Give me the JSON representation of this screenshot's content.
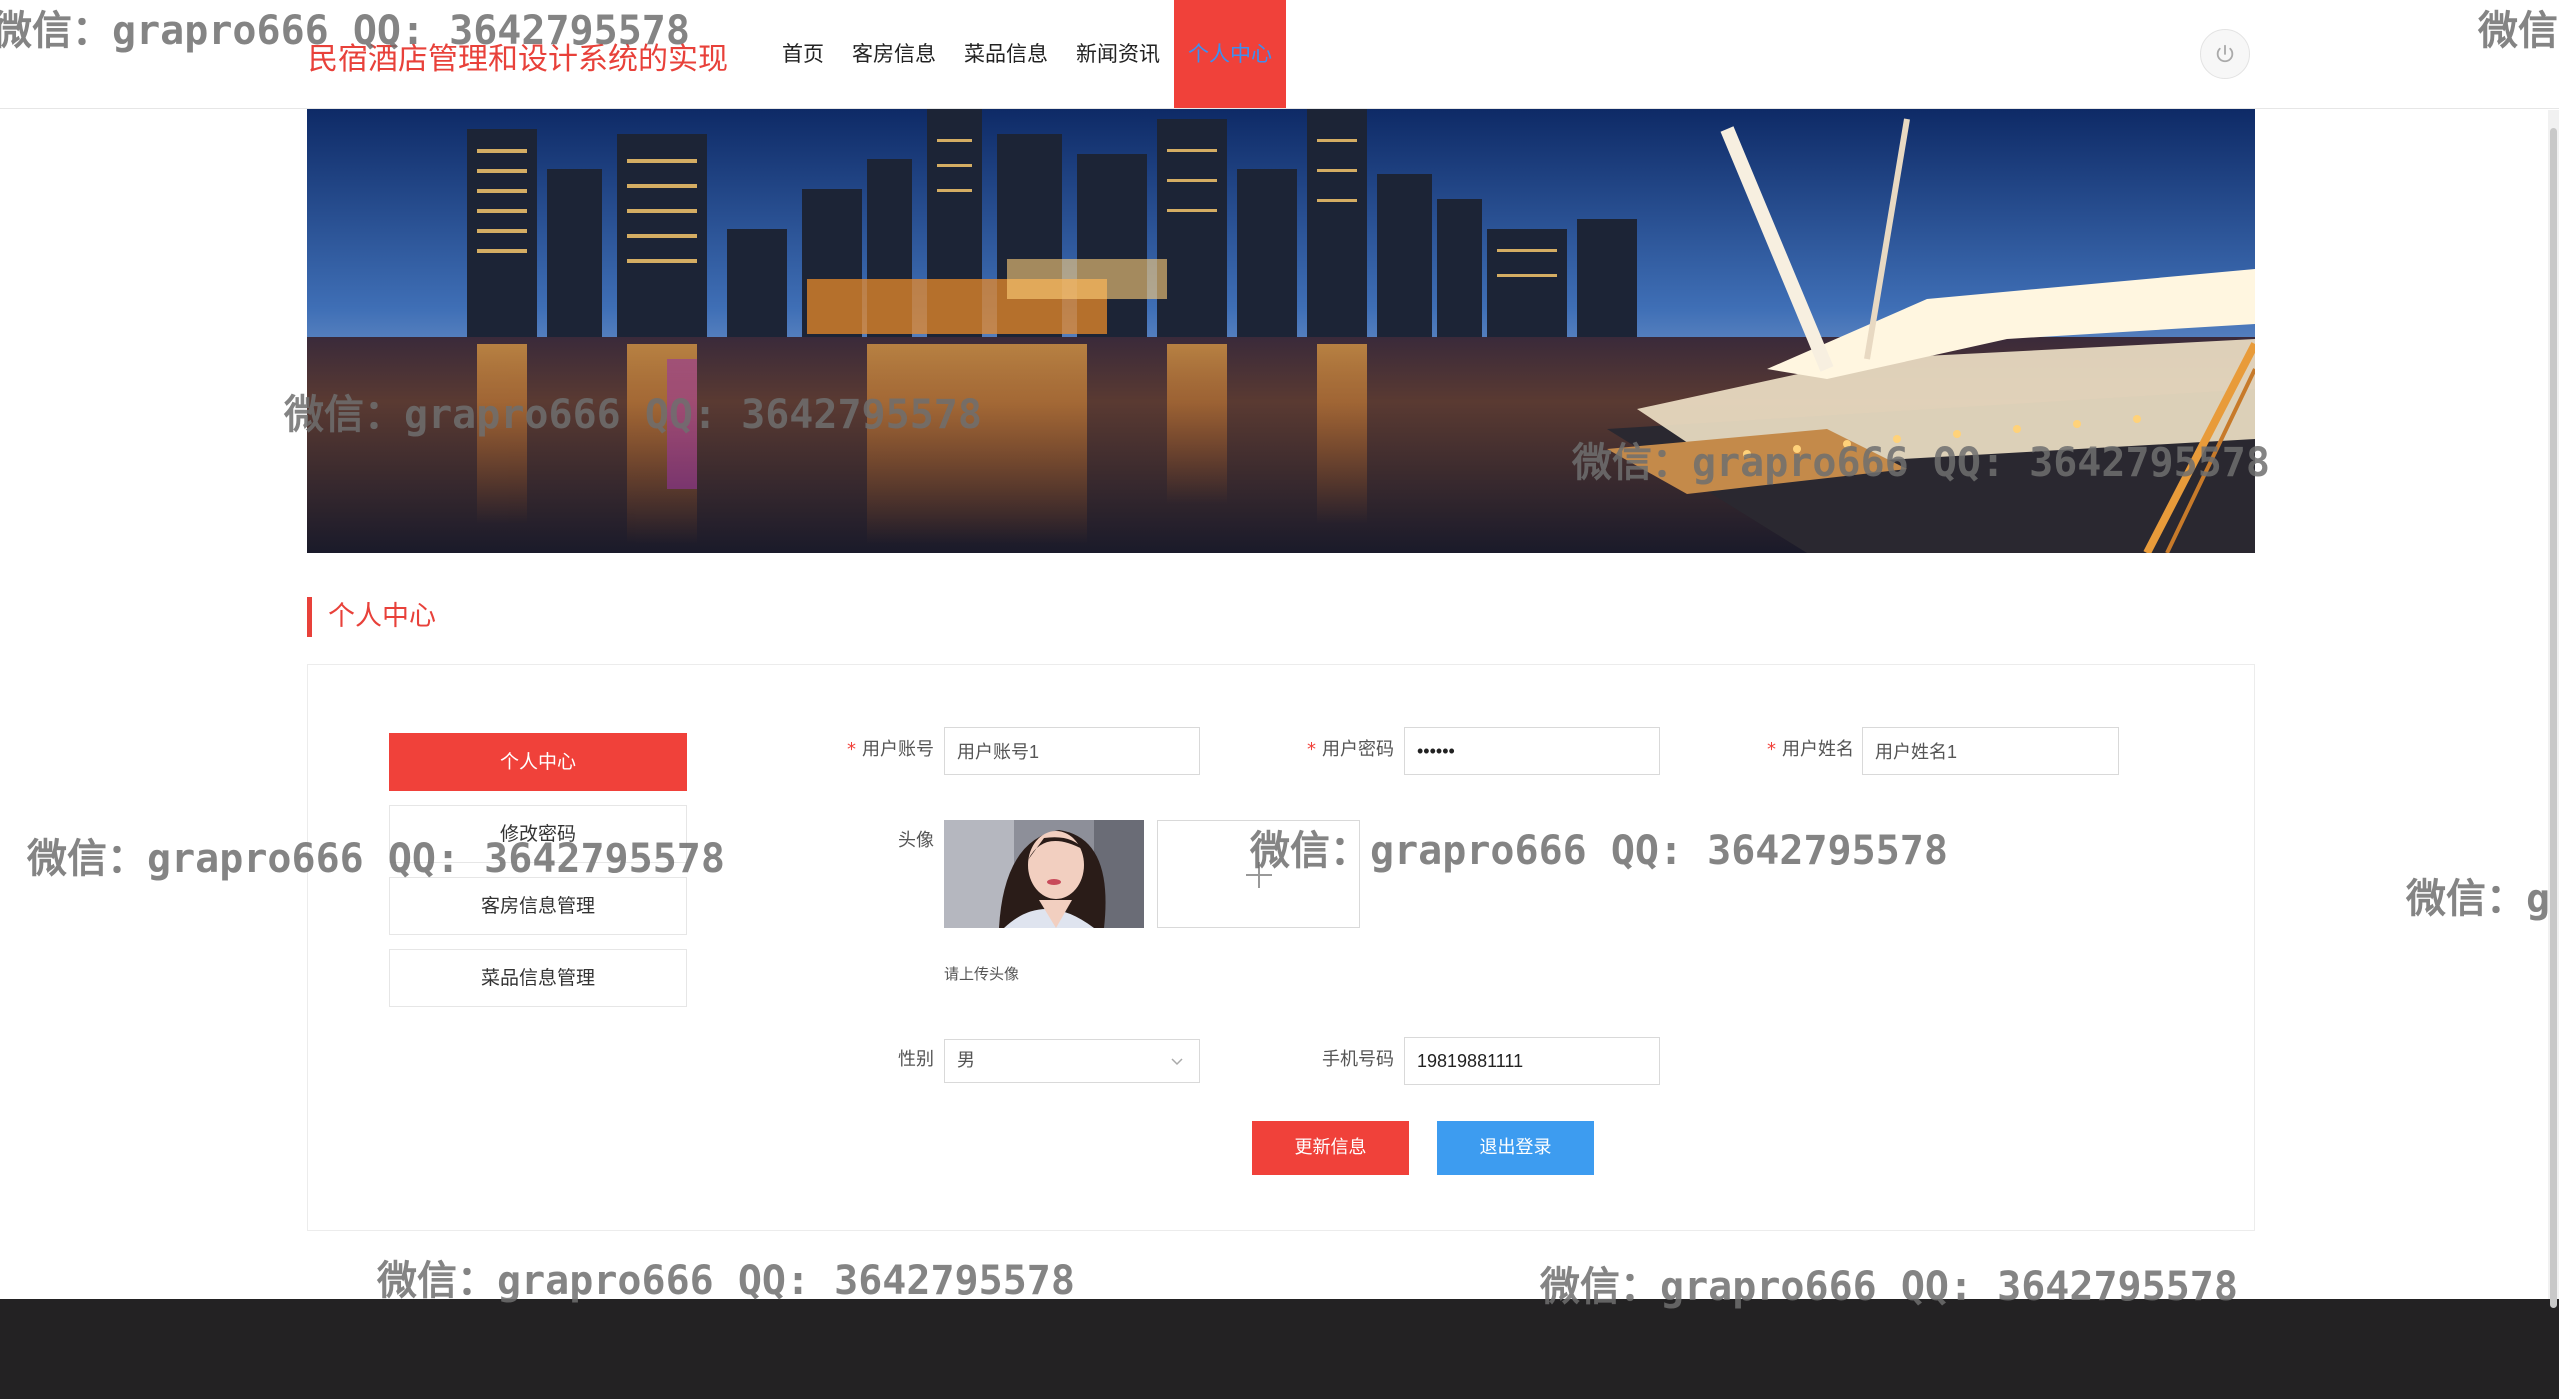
{
  "header": {
    "site_title": "民宿酒店管理和设计系统的实现",
    "nav": [
      {
        "label": "首页"
      },
      {
        "label": "客房信息"
      },
      {
        "label": "菜品信息"
      },
      {
        "label": "新闻资讯"
      },
      {
        "label": "个人中心",
        "active": true
      }
    ],
    "power_icon": "power-icon"
  },
  "section": {
    "title": "个人中心"
  },
  "side_menu": {
    "items": [
      {
        "label": "个人中心",
        "active": true
      },
      {
        "label": "修改密码"
      },
      {
        "label": "客房信息管理"
      },
      {
        "label": "菜品信息管理"
      }
    ]
  },
  "form": {
    "account": {
      "label": "用户账号",
      "value": "用户账号1"
    },
    "password": {
      "label": "用户密码",
      "value": "••••••"
    },
    "name": {
      "label": "用户姓名",
      "value": "用户姓名1"
    },
    "avatar": {
      "label": "头像",
      "hint": "请上传头像",
      "upload_icon": "plus-icon"
    },
    "gender": {
      "label": "性别",
      "value": "男"
    },
    "phone": {
      "label": "手机号码",
      "value": "19819881111"
    },
    "update_label": "更新信息",
    "logout_label": "退出登录"
  },
  "colors": {
    "accent": "#f0413a",
    "nav_active_text": "#3d8ff0",
    "logout_button": "#3d9cf0",
    "footer": "#232223"
  },
  "watermark": "微信：grapro666 QQ: 3642795578"
}
